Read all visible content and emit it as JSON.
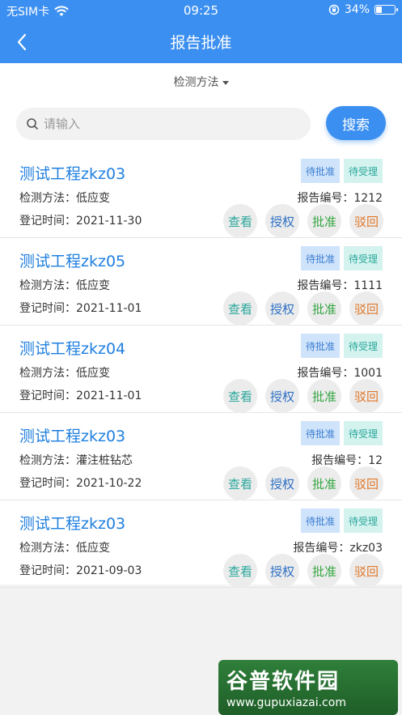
{
  "status_bar": {
    "carrier": "无SIM卡",
    "time": "09:25",
    "battery": "34%",
    "battery_level": 0.34
  },
  "nav": {
    "title": "报告批准"
  },
  "filter": {
    "label": "检测方法"
  },
  "search": {
    "placeholder": "请输入",
    "value": "",
    "button_label": "搜索"
  },
  "labels": {
    "method": "检测方法：",
    "date": "登记时间：",
    "report": "报告编号："
  },
  "badges": {
    "pending_approve": "待批准",
    "pending_accept": "待受理"
  },
  "actions": {
    "view": "查看",
    "authorize": "授权",
    "approve": "批准",
    "reject": "驳回"
  },
  "items": [
    {
      "name": "测试工程zkz03",
      "method": "低应变",
      "date": "2021-11-30",
      "report_no": "1212"
    },
    {
      "name": "测试工程zkz05",
      "method": "低应变",
      "date": "2021-11-01",
      "report_no": "1111"
    },
    {
      "name": "测试工程zkz04",
      "method": "低应变",
      "date": "2021-11-01",
      "report_no": "1001"
    },
    {
      "name": "测试工程zkz03",
      "method": "灌注桩钻芯",
      "date": "2021-10-22",
      "report_no": "12"
    },
    {
      "name": "测试工程zkz03",
      "method": "低应变",
      "date": "2021-09-03",
      "report_no": "zkz03"
    }
  ],
  "watermark": {
    "title": "谷普软件园",
    "url": "www.gupuxiazai.com"
  }
}
